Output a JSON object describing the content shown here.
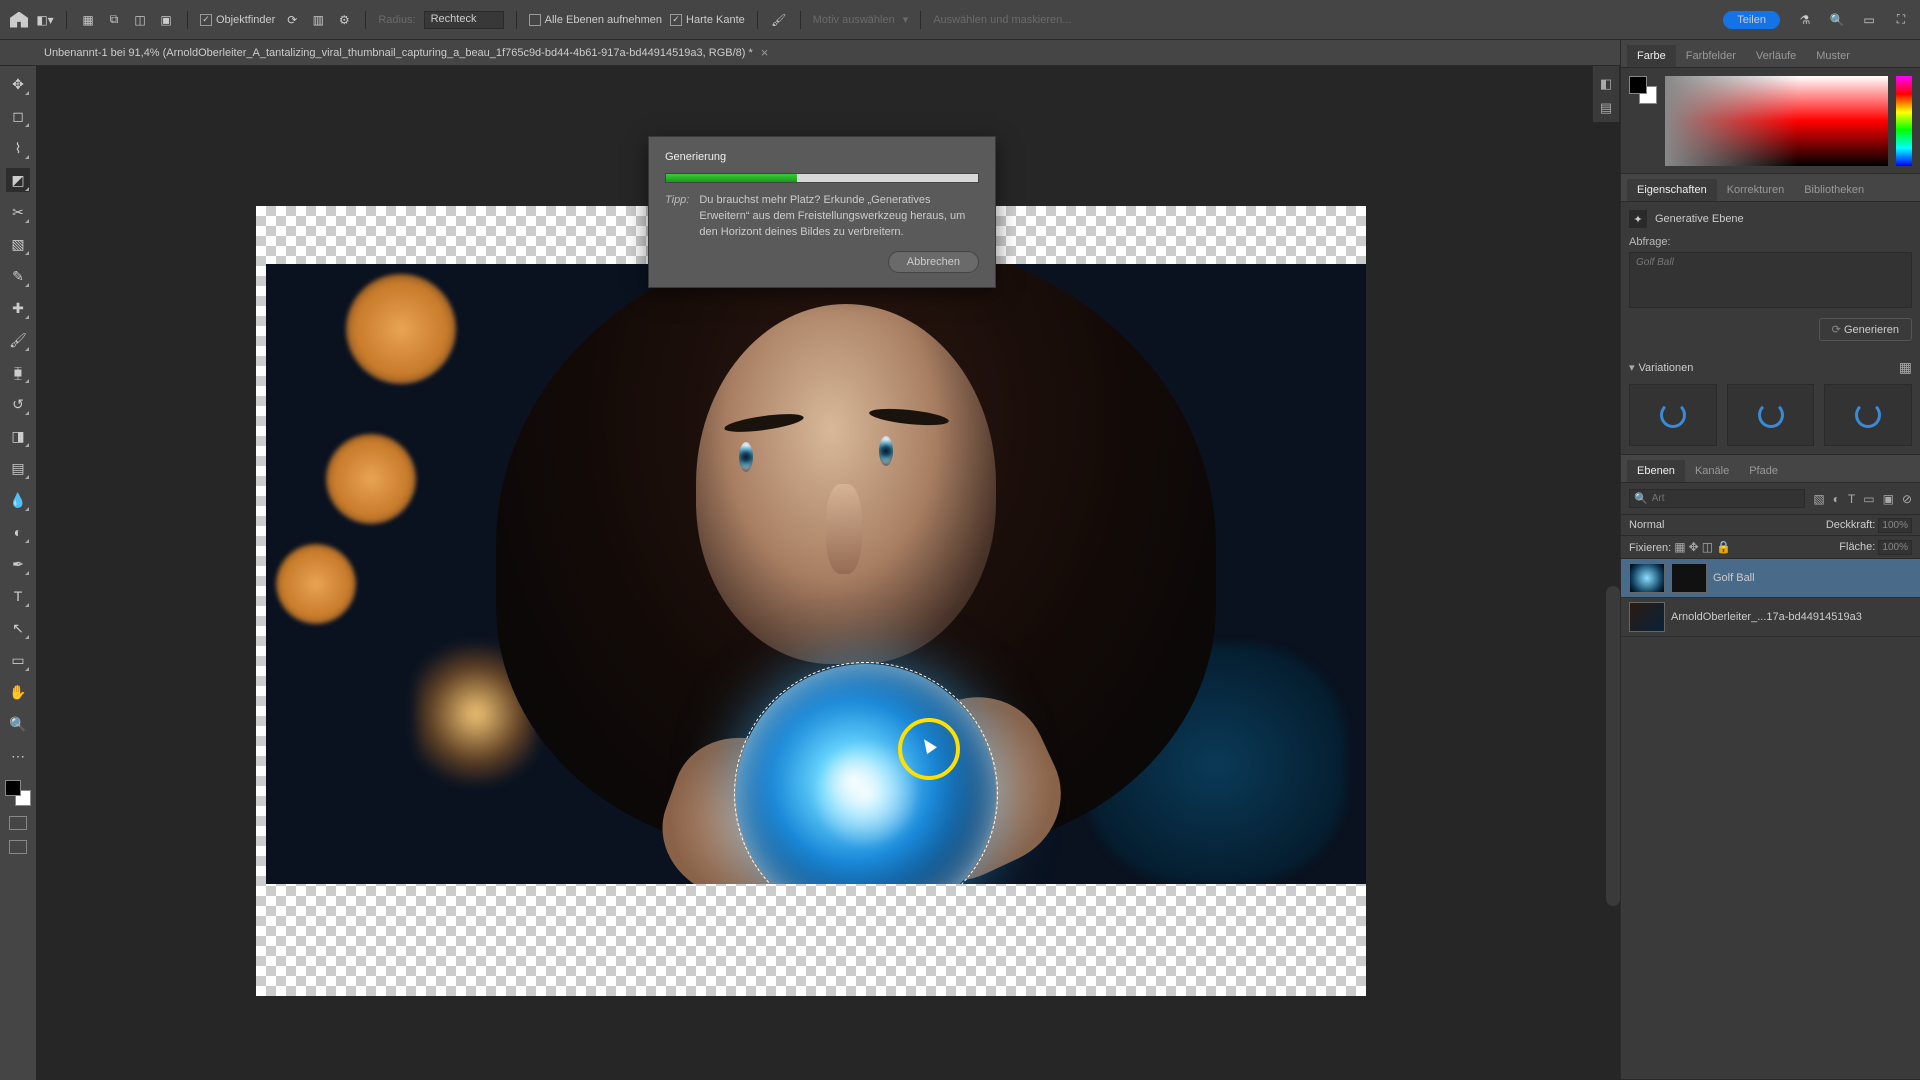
{
  "menubar": {
    "objektfinder": "Objektfinder",
    "radius_label": "Radius:",
    "radius_value": "Rechteck",
    "alle_ebenen": "Alle Ebenen aufnehmen",
    "harte_kante": "Harte Kante",
    "motiv": "Motiv auswählen",
    "auswaehlen": "Auswählen und maskieren...",
    "teilen": "Teilen"
  },
  "doctab": {
    "title": "Unbenannt-1 bei 91,4% (ArnoldOberleiter_A_tantalizing_viral_thumbnail_capturing_a_beau_1f765c9d-bd44-4b61-917a-bd44914519a3, RGB/8) *"
  },
  "dialog": {
    "title": "Generierung",
    "tip_label": "Tipp:",
    "tip_text": "Du brauchst mehr Platz? Erkunde „Generatives Erweitern“ aus dem Freistellungswerkzeug heraus, um den Horizont deines Bildes zu verbreitern.",
    "cancel": "Abbrechen",
    "progress_pct": 42
  },
  "panels": {
    "color": {
      "tabs": [
        "Farbe",
        "Farbfelder",
        "Verläufe",
        "Muster"
      ],
      "active": 0
    },
    "props": {
      "tabs": [
        "Eigenschaften",
        "Korrekturen",
        "Bibliotheken"
      ],
      "active": 0,
      "gen_layer": "Generative Ebene",
      "abfrage": "Abfrage:",
      "prompt_placeholder": "Golf Ball",
      "generieren": "Generieren",
      "variationen": "Variationen"
    },
    "layers": {
      "tabs": [
        "Ebenen",
        "Kanäle",
        "Pfade"
      ],
      "active": 0,
      "search_placeholder": "Art",
      "mode": "Normal",
      "deckkraft_label": "Deckkraft:",
      "deckkraft_value": "100%",
      "fixieren": "Fixieren:",
      "flaeche_label": "Fläche:",
      "flaeche_value": "100%",
      "items": [
        {
          "name": "Golf Ball"
        },
        {
          "name": "ArnoldOberleiter_...17a-bd44914519a3"
        }
      ]
    }
  }
}
